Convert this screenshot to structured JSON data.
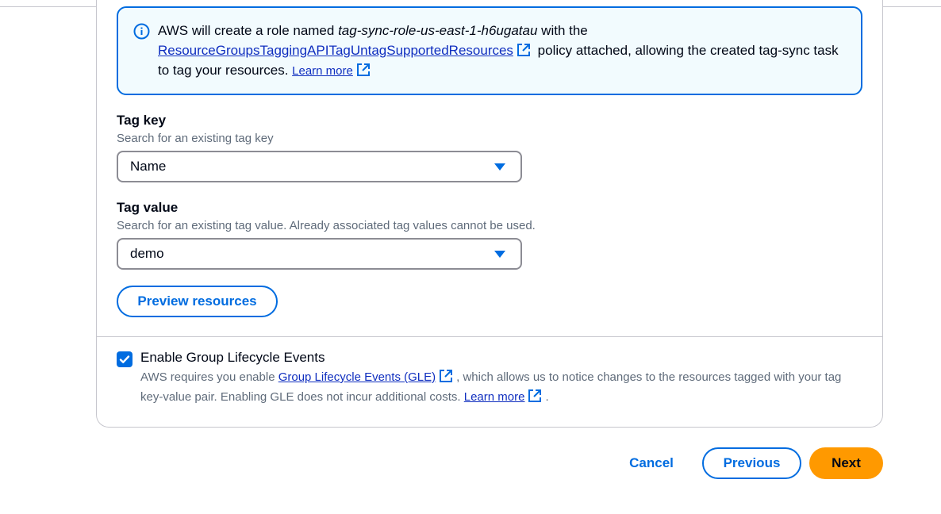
{
  "alert": {
    "text_prefix": "AWS will create a role named ",
    "role_name": "tag-sync-role-us-east-1-h6ugatau",
    "text_mid": " with the",
    "policy_link": "ResourceGroupsTaggingAPITagUntagSupportedResources",
    "text_suffix": " policy attached, allowing the created tag-sync task to tag your resources. ",
    "learn_more": "Learn more"
  },
  "tag_key": {
    "label": "Tag key",
    "description": "Search for an existing tag key",
    "value": "Name"
  },
  "tag_value": {
    "label": "Tag value",
    "description": "Search for an existing tag value. Already associated tag values cannot be used.",
    "value": "demo"
  },
  "preview_button": "Preview resources",
  "gle": {
    "checked": true,
    "label": "Enable Group Lifecycle Events",
    "desc_prefix": "AWS requires you enable ",
    "gle_link": "Group Lifecycle Events (GLE)",
    "desc_mid": ", which allows us to notice changes to the resources tagged with your tag key-value pair. Enabling GLE does not incur additional costs. ",
    "learn_more": "Learn more",
    "desc_end": "."
  },
  "footer": {
    "cancel": "Cancel",
    "previous": "Previous",
    "next": "Next"
  },
  "colors": {
    "accent": "#006ce0",
    "primary": "#ff9900",
    "alert_bg": "#f2fbfe",
    "link": "#0f2ebf"
  }
}
